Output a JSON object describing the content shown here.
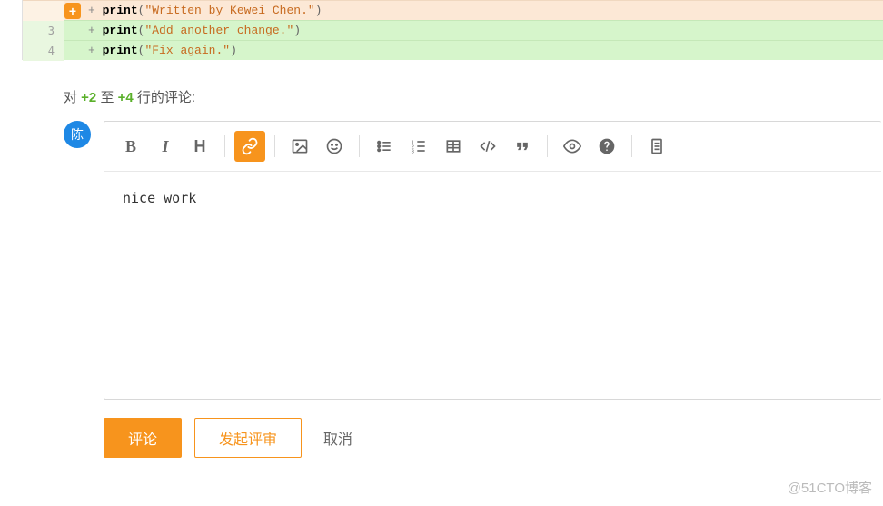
{
  "diff": {
    "lines": [
      {
        "num": "",
        "prefix": "+ ",
        "fn": "print",
        "str": "\"Written by Kewei Chen.\""
      },
      {
        "num": "3",
        "prefix": "+ ",
        "fn": "print",
        "str": "\"Add another change.\""
      },
      {
        "num": "4",
        "prefix": "+ ",
        "fn": "print",
        "str": "\"Fix again.\""
      }
    ],
    "add_icon": "+"
  },
  "comment": {
    "label_prefix": "对 ",
    "range_from": "+2",
    "label_mid": " 至 ",
    "range_to": "+4",
    "label_suffix": " 行的评论:",
    "avatar": "陈",
    "body": "nice work"
  },
  "toolbar": {
    "bold": "B",
    "italic": "I",
    "heading": "H"
  },
  "actions": {
    "submit": "评论",
    "review": "发起评审",
    "cancel": "取消"
  },
  "watermark": "@51CTO博客"
}
